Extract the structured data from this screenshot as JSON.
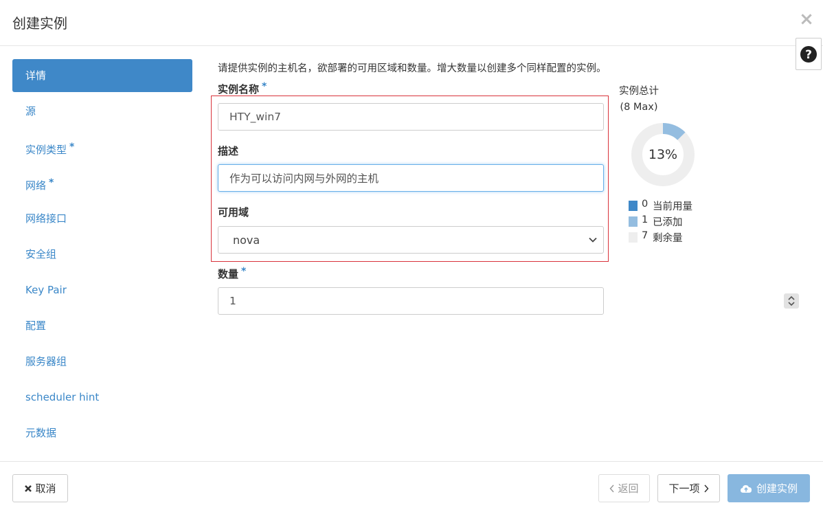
{
  "modal": {
    "title": "创建实例",
    "close_glyph": "×",
    "help_glyph": "?"
  },
  "sidebar": {
    "items": [
      {
        "label": "详情",
        "required": false,
        "active": true
      },
      {
        "label": "源",
        "required": false,
        "active": false
      },
      {
        "label": "实例类型",
        "required": true,
        "active": false
      },
      {
        "label": "网络",
        "required": true,
        "active": false
      },
      {
        "label": "网络接口",
        "required": false,
        "active": false
      },
      {
        "label": "安全组",
        "required": false,
        "active": false
      },
      {
        "label": "Key Pair",
        "required": false,
        "active": false
      },
      {
        "label": "配置",
        "required": false,
        "active": false
      },
      {
        "label": "服务器组",
        "required": false,
        "active": false
      },
      {
        "label": "scheduler hint",
        "required": false,
        "active": false
      },
      {
        "label": "元数据",
        "required": false,
        "active": false
      }
    ],
    "required_mark": "*"
  },
  "form": {
    "intro": "请提供实例的主机名，欲部署的可用区域和数量。增大数量以创建多个同样配置的实例。",
    "instance_name": {
      "label": "实例名称",
      "required_mark": "*",
      "value": "HTY_win7"
    },
    "description": {
      "label": "描述",
      "value": "作为可以访问内网与外网的主机"
    },
    "availability_zone": {
      "label": "可用域",
      "selected": "nova"
    },
    "count": {
      "label": "数量",
      "required_mark": "*",
      "value": "1"
    }
  },
  "quota": {
    "title": "实例总计",
    "subtitle": "(8 Max)",
    "percent_label": "13%",
    "max": 8,
    "legend": [
      {
        "count": "0",
        "label": "当前用量",
        "color": "#3f88c8"
      },
      {
        "count": "1",
        "label": "已添加",
        "color": "#94bde0"
      },
      {
        "count": "7",
        "label": "剩余量",
        "color": "#eeeeee"
      }
    ]
  },
  "footer": {
    "cancel_label": "取消",
    "back_label": "返回",
    "next_label": "下一项",
    "create_label": "创建实例"
  },
  "colors": {
    "accent": "#3f88c8",
    "highlight_border": "#d9323a",
    "primary_disabled": "#88b7df"
  }
}
